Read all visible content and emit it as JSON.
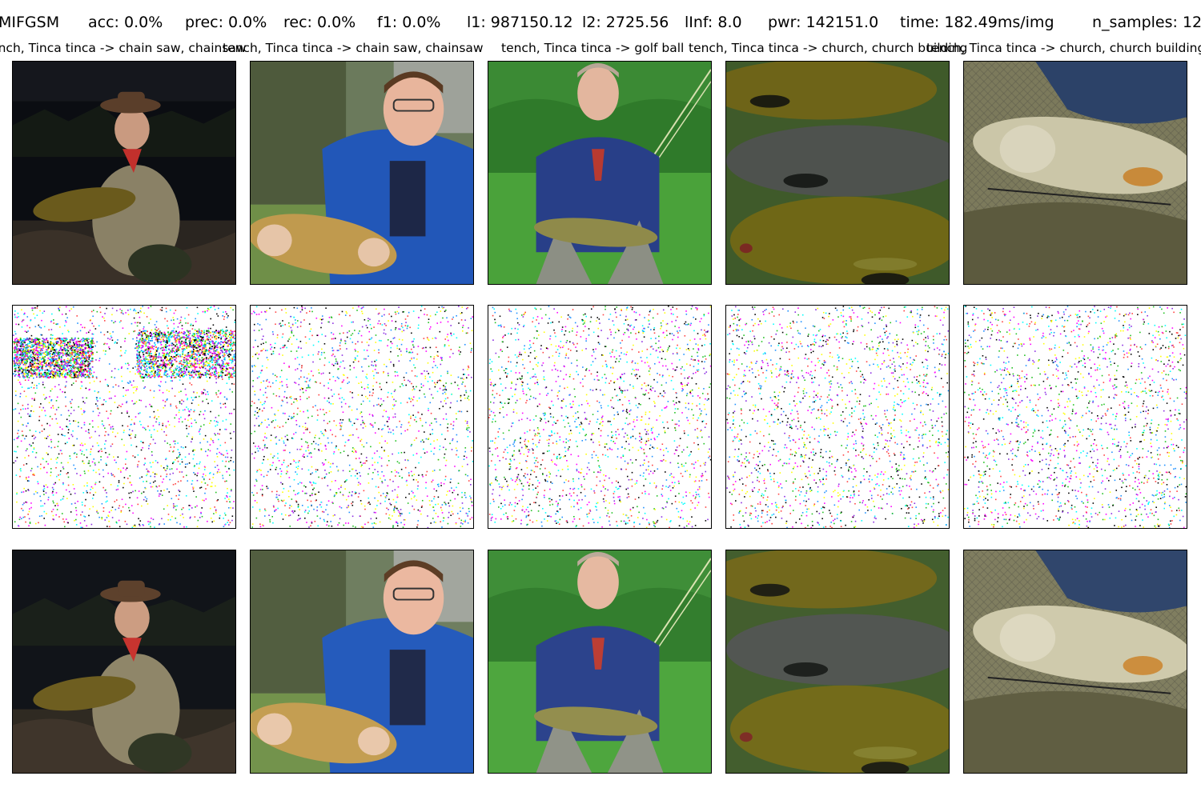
{
  "header": {
    "method": "MIFGSM",
    "acc": "acc: 0.0%",
    "prec": "prec: 0.0%",
    "rec": "rec: 0.0%",
    "f1": "f1: 0.0%",
    "l1": "l1: 987150.12",
    "l2": "l2: 2725.56",
    "linf": "lInf: 8.0",
    "pwr": "pwr: 142151.0",
    "time": "time: 182.49ms/img",
    "n_samples": "n_samples: 12"
  },
  "columns": [
    {
      "caption": "tench, Tinca tinca -> chain saw, chainsaw"
    },
    {
      "caption": "tench, Tinca tinca -> chain saw, chainsaw"
    },
    {
      "caption": "tench, Tinca tinca -> golf ball"
    },
    {
      "caption": "tench, Tinca tinca -> church, church building"
    },
    {
      "caption": "tench, Tinca tinca -> church, church building"
    }
  ],
  "rows": [
    {
      "kind": "original"
    },
    {
      "kind": "perturbation"
    },
    {
      "kind": "adversarial"
    }
  ],
  "colors": {
    "noise": [
      "#ff00ff",
      "#00ffff",
      "#ffff00",
      "#8a2be2",
      "#ff4040",
      "#20c020",
      "#000000",
      "#1e90ff"
    ]
  }
}
